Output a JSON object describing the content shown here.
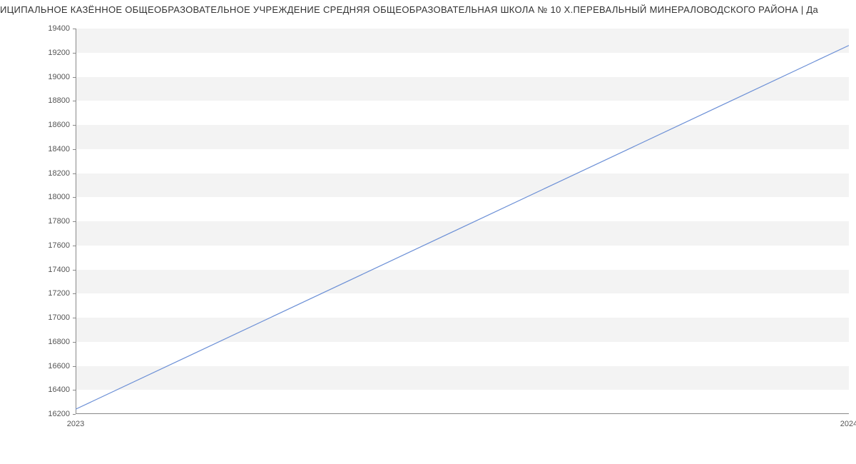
{
  "chart_data": {
    "type": "line",
    "title": "ИЦИПАЛЬНОЕ КАЗЁННОЕ ОБЩЕОБРАЗОВАТЕЛЬНОЕ УЧРЕЖДЕНИЕ СРЕДНЯЯ ОБЩЕОБРАЗОВАТЕЛЬНАЯ ШКОЛА № 10 Х.ПЕРЕВАЛЬНЫЙ МИНЕРАЛОВОДСКОГО РАЙОНА | Да",
    "x": [
      "2023",
      "2024"
    ],
    "values": [
      16240,
      19260
    ],
    "xlabel": "",
    "ylabel": "",
    "ylim": [
      16200,
      19400
    ],
    "y_ticks": [
      16200,
      16400,
      16600,
      16800,
      17000,
      17200,
      17400,
      17600,
      17800,
      18000,
      18200,
      18400,
      18600,
      18800,
      19000,
      19200,
      19400
    ],
    "line_color": "#6b8fd6"
  }
}
